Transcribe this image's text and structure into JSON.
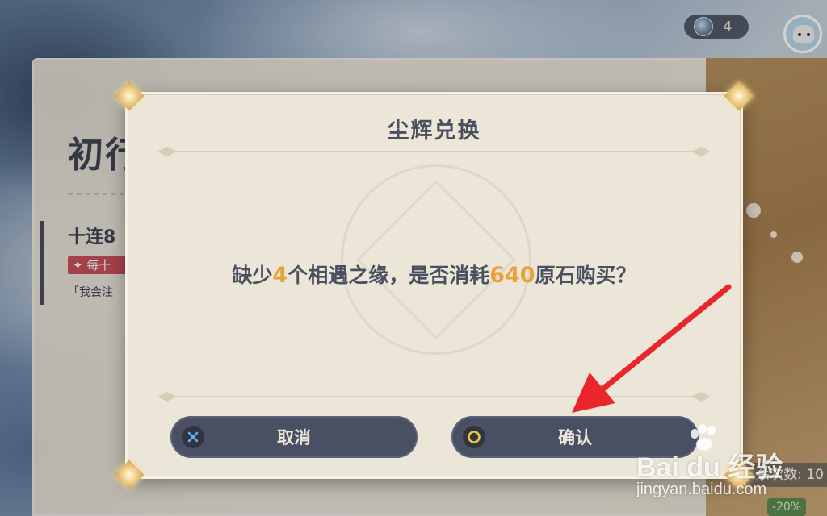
{
  "background": {
    "banner_title": "初行",
    "banner_subtitle": "十连8",
    "banner_badge": "✦ 每十",
    "banner_quote": "「我会注",
    "currency_count": "4",
    "currency_icon": "starglitter-gem-icon",
    "wish_count_label": "余次数: 10",
    "discount_label": "-20%"
  },
  "dialog": {
    "title": "尘辉兑换",
    "message_prefix": "缺少",
    "message_qty": "4",
    "message_middle": "个相遇之缘，是否消耗",
    "message_cost": "640",
    "message_suffix": "原石购买？",
    "cancel_label": "取消",
    "confirm_label": "确认",
    "cancel_icon": "cross-icon",
    "confirm_icon": "circle-icon"
  },
  "watermark": {
    "logo_text": "Bai du 经验",
    "url": "jingyan.baidu.com"
  },
  "colors": {
    "highlight": "#e9a23b",
    "button_bg": "#4a5064",
    "dialog_bg": "#ece6d9",
    "annotation_arrow": "#e8262b"
  }
}
